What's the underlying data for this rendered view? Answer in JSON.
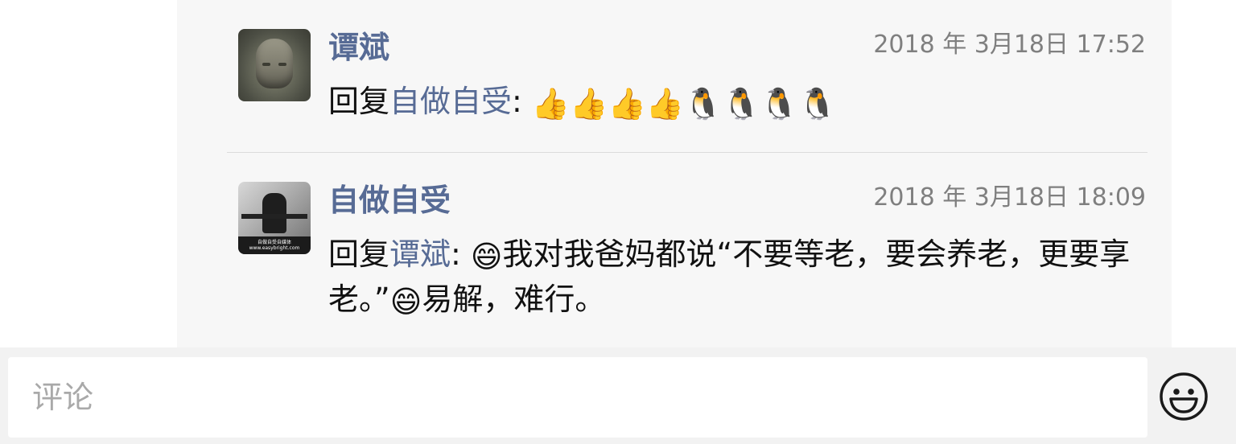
{
  "comments": [
    {
      "author": "谭斌",
      "timestamp": "2018 年 3月18日 17:52",
      "reply_prefix": "回复",
      "reply_to": "自做自受",
      "separator": ": ",
      "text": "👍👍👍👍🐧🐧🐧🐧"
    },
    {
      "author": "自做自受",
      "timestamp": "2018 年 3月18日 18:09",
      "reply_prefix": "回复",
      "reply_to": "谭斌",
      "separator": ": ",
      "emoji": "😄",
      "text_part1": "我对我爸妈都说“不要等老，要会养老，更要享老。”",
      "text_part2": "易解，难行。",
      "avatar_caption": "自做自受自媒体 www.easybright.com"
    }
  ],
  "comment_input": {
    "placeholder": "评论"
  },
  "icons": {
    "emoji_button": "smiley-face-icon"
  }
}
